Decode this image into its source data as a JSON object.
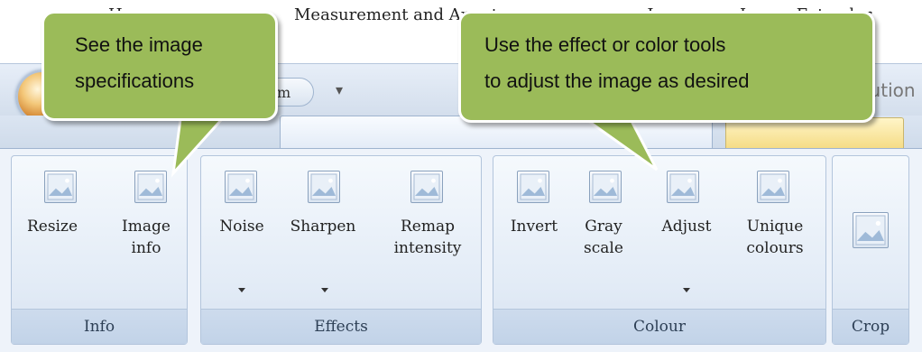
{
  "window": {
    "quick_access_fragment": "m",
    "qat_dropdown_glyph": "▾",
    "title_fragment": "lution"
  },
  "tabs": [
    {
      "label": "Home"
    },
    {
      "label": "ew"
    },
    {
      "label": "Measurement and Annota"
    },
    {
      "label": "n Image"
    },
    {
      "label": "Image Extender"
    }
  ],
  "groups": {
    "info": {
      "label": "Info",
      "buttons": [
        {
          "label": "Resize",
          "icon": "image-icon"
        },
        {
          "label": "Image\ninfo",
          "icon": "image-icon"
        }
      ]
    },
    "effects": {
      "label": "Effects",
      "buttons": [
        {
          "label": "Noise",
          "icon": "image-icon",
          "dropdown": true
        },
        {
          "label": "Sharpen",
          "icon": "image-icon",
          "dropdown": true
        },
        {
          "label": "Remap\nintensity",
          "icon": "image-icon"
        }
      ]
    },
    "colour": {
      "label": "Colour",
      "buttons": [
        {
          "label": "Invert",
          "icon": "image-icon"
        },
        {
          "label": "Gray\nscale",
          "icon": "image-icon"
        },
        {
          "label": "Adjust",
          "icon": "image-icon",
          "dropdown": true
        },
        {
          "label": "Unique\ncolours",
          "icon": "image-icon"
        }
      ]
    },
    "crop": {
      "label": "Crop",
      "buttons": [
        {
          "label": "",
          "icon": "image-icon"
        }
      ]
    }
  },
  "callouts": {
    "left": {
      "line1": "See the image",
      "line2": "specifications"
    },
    "right": {
      "line1": "Use the effect or color tools",
      "line2": "to adjust the image as desired"
    }
  },
  "colors": {
    "callout_fill": "#9bbb59",
    "ribbon_bg": "#eef3fa"
  }
}
